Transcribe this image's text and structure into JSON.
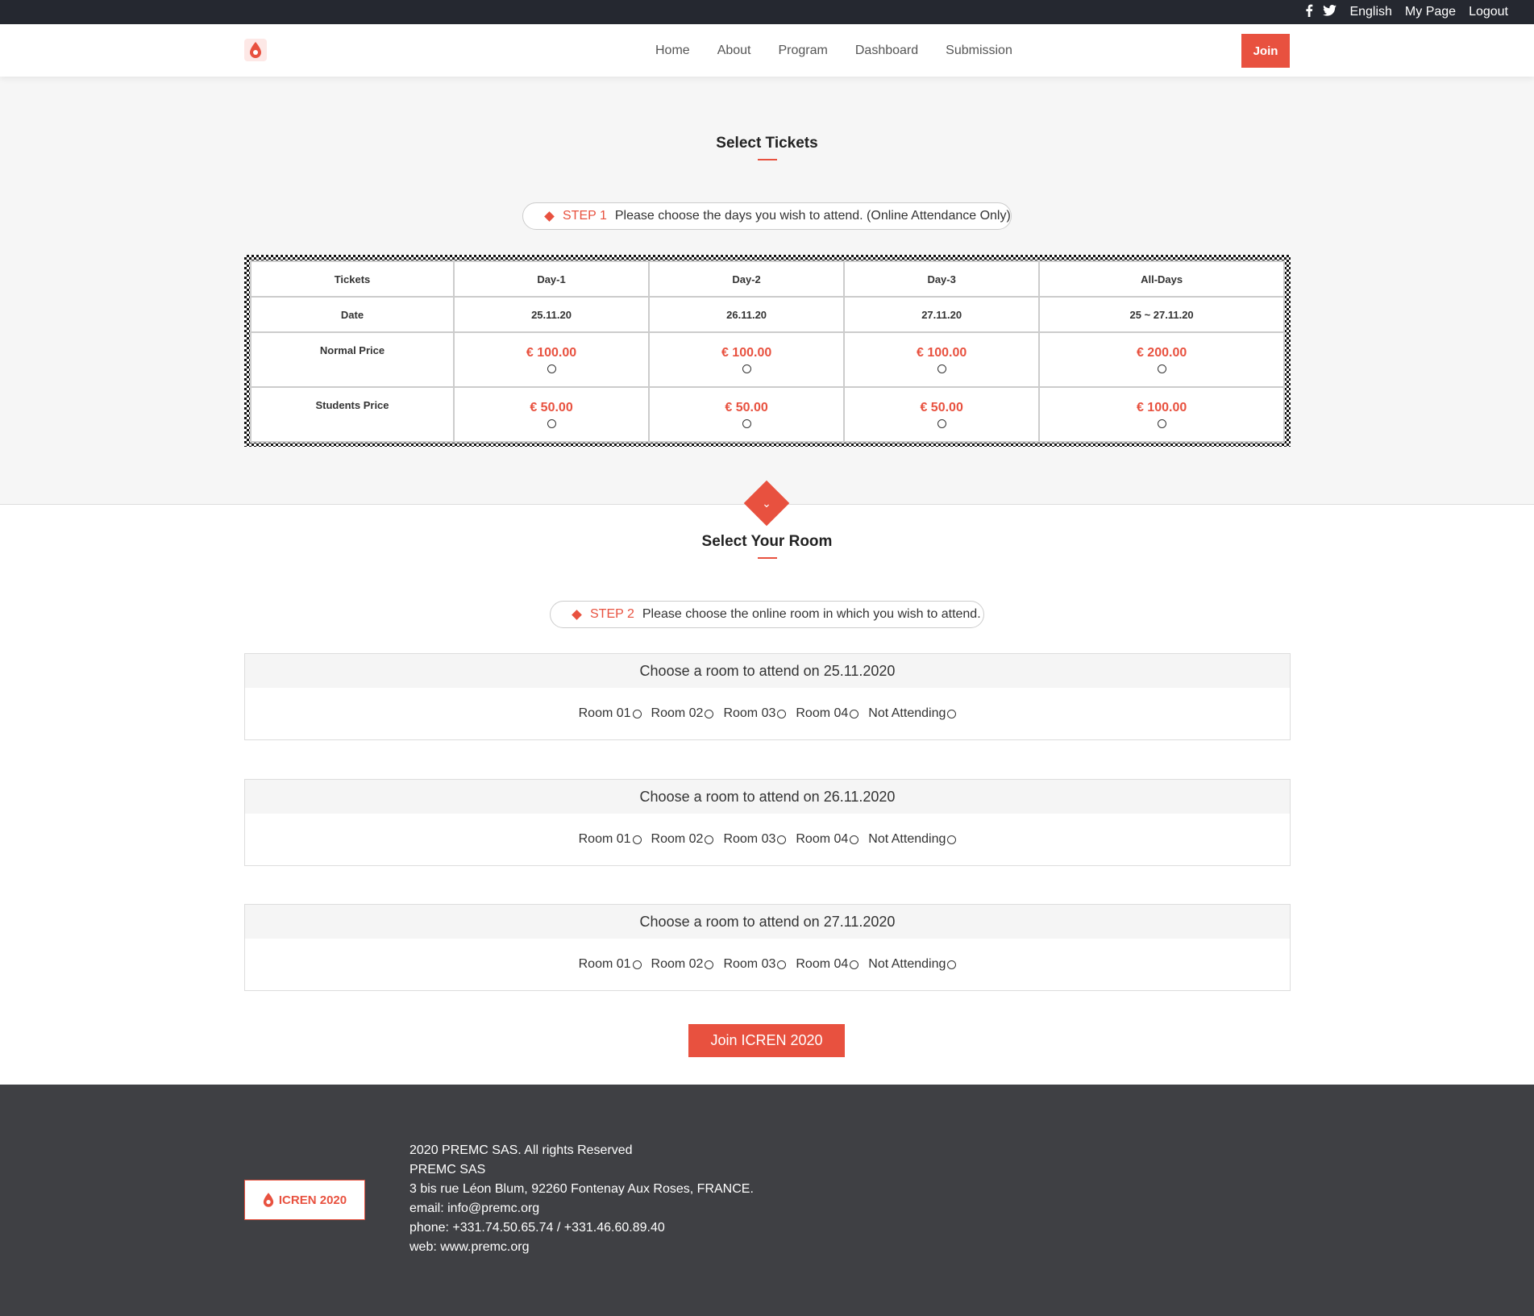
{
  "topbar": {
    "social": [
      "facebook-icon",
      "twitter-icon"
    ],
    "language": "English",
    "my_page": "My Page",
    "logout": "Logout"
  },
  "nav": {
    "links": [
      "Home",
      "About",
      "Program",
      "Dashboard",
      "Submission"
    ],
    "join": "Join"
  },
  "tickets_section": {
    "title": "Select Tickets",
    "step_label": "STEP 1",
    "step_text": "Please choose the days you wish to attend. (Online Attendance Only)",
    "headers": [
      "Tickets",
      "Day-1",
      "Day-2",
      "Day-3",
      "All-Days"
    ],
    "date_row": {
      "label": "Date",
      "values": [
        "25.11.20",
        "26.11.20",
        "27.11.20",
        "25 ~ 27.11.20"
      ]
    },
    "normal_row": {
      "label": "Normal Price",
      "values": [
        "€ 100.00",
        "€ 100.00",
        "€ 100.00",
        "€ 200.00"
      ]
    },
    "student_row": {
      "label": "Students Price",
      "values": [
        "€ 50.00",
        "€ 50.00",
        "€ 50.00",
        "€ 100.00"
      ]
    }
  },
  "room_section": {
    "title": "Select Your Room",
    "step_label": "STEP 2",
    "step_text": "Please choose the online room in which you wish to attend.",
    "panels": [
      {
        "heading": "Choose a room to attend on 25.11.2020",
        "options": [
          "Room 01",
          "Room 02",
          "Room 03",
          "Room 04",
          "Not Attending"
        ]
      },
      {
        "heading": "Choose a room to attend on 26.11.2020",
        "options": [
          "Room 01",
          "Room 02",
          "Room 03",
          "Room 04",
          "Not Attending"
        ]
      },
      {
        "heading": "Choose a room to attend on 27.11.2020",
        "options": [
          "Room 01",
          "Room 02",
          "Room 03",
          "Room 04",
          "Not Attending"
        ]
      }
    ],
    "submit": "Join ICREN 2020"
  },
  "footer": {
    "logo_text": "ICREN 2020",
    "lines": [
      "2020 PREMC SAS. All rights Reserved",
      "PREMC SAS",
      "3 bis rue Léon Blum, 92260 Fontenay Aux Roses, FRANCE.",
      "email: info@premc.org",
      "phone: +331.74.50.65.74 / +331.46.60.89.40",
      "web: www.premc.org"
    ]
  },
  "colors": {
    "accent": "#e8513f",
    "topbar": "#252830",
    "footer": "#3f4044"
  }
}
